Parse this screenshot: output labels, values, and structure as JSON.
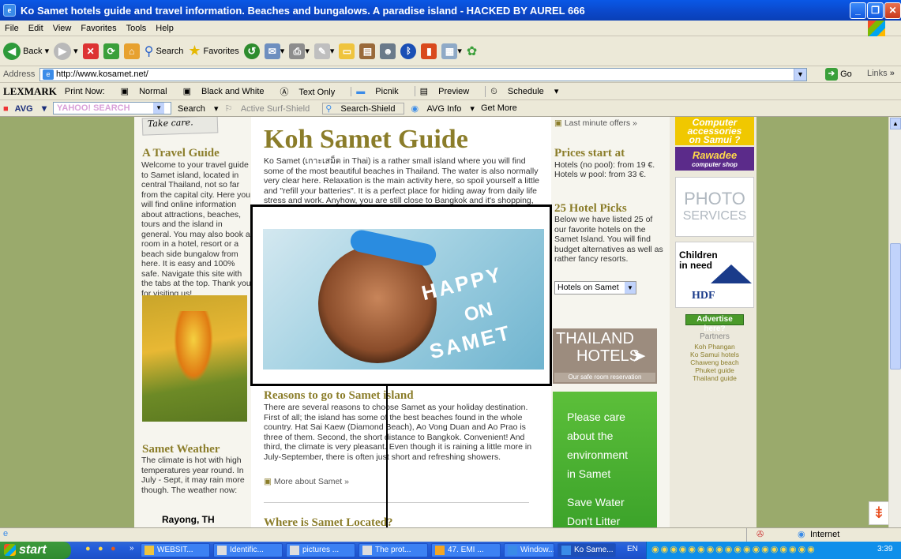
{
  "window": {
    "title": "Ko Samet hotels guide and travel information. Beaches and bungalows. A paradise island - HACKED BY AUREL 666"
  },
  "menu": [
    "File",
    "Edit",
    "View",
    "Favorites",
    "Tools",
    "Help"
  ],
  "toolbar": {
    "back": "Back",
    "search": "Search",
    "favorites": "Favorites"
  },
  "address": {
    "label": "Address",
    "url": "http://www.kosamet.net/",
    "go": "Go",
    "links": "Links"
  },
  "lexmark": {
    "brand": "LEXMARK",
    "print_now": "Print Now:",
    "normal": "Normal",
    "bw": "Black and White",
    "text_only": "Text Only",
    "picnik": "Picnik",
    "preview": "Preview",
    "schedule": "Schedule"
  },
  "avg": {
    "brand": "AVG",
    "search_box": "YAHOO! SEARCH",
    "search": "Search",
    "surf": "Active Surf-Shield",
    "search_shield": "Search-Shield",
    "info": "AVG Info",
    "more": "Get More"
  },
  "page": {
    "take_care": "Take care.",
    "left_title": "A Travel Guide",
    "left_body": "Welcome to your travel guide to Samet island, located in central Thailand, not so far from the capital city. Here you will find online information about attractions, beaches, tours and the island in general. You may also book a room in a hotel, resort or a beach side bungalow from here. It is easy and 100% safe. Navigate this site with the tabs at the top. Thank you for visiting us!",
    "weather_title": "Samet Weather",
    "weather_body": "The climate is hot with high temperatures year round. In July - Sept, it may rain more though. The weather now:",
    "weather_loc": "Rayong, TH",
    "main_title": "Koh Samet Guide",
    "main_intro": "Ko Samet (เกาะเสม็ด in Thai) is a rather small island where you will find some of the most beautiful beaches in Thailand. The water is also normally very clear here. Relaxation is the main activity here, so spoil yourself a little and \"refill your batteries\". It is a perfect place for hiding away from daily life stress and work. Anyhow, you are still close to Bangkok and it's shopping, night life and attractions.",
    "photo_caption_1": "HAPPY",
    "photo_caption_2": "ON",
    "photo_caption_3": "SAMET",
    "reasons_title": "Reasons to go to Samet island",
    "reasons_body": "There are several reasons to choose Samet as your holiday destination. First of all; the island has some of the best beaches found in the whole country. Hat Sai Kaew (Diamond Beach), Ao Vong Duan and Ao Prao is three of them. Second, the short distance to Bangkok. Convenient! And third, the climate is very pleasant. Even though it is raining a little more in July-September, there is often just short and refreshing showers.",
    "more_link": "More about Samet »",
    "where_title": "Where is Samet Located?",
    "last_minute": "Last minute offers »",
    "prices_title": "Prices start at",
    "prices_body_1": "Hotels (no pool): from 19 €.",
    "prices_body_2": "Hotels w pool: from 33 €.",
    "picks_title": "25 Hotel Picks",
    "picks_body": "Below we have listed 25 of our favorite hotels on the Samet Island. You will find budget alternatives as well as rather fancy resorts.",
    "hotels_select": "Hotels on Samet",
    "thai_hotels_1": "THAILAND",
    "thai_hotels_2": "HOTELS",
    "thai_hotels_sub": "Our safe room reservation",
    "env_1": "Please care",
    "env_2": "about the",
    "env_3": "environment",
    "env_4": "in Samet",
    "env_5": "Save Water",
    "env_6": "Don't Litter",
    "ad_computer_1": "Computer",
    "ad_computer_2": "accessories",
    "ad_computer_3": "on Samui ?",
    "rawadee": "Rawadee",
    "rawadee_sub": "computer shop",
    "photo_1": "PHOTO",
    "photo_2": "SERVICES",
    "children_1": "Children",
    "children_2": "in need",
    "hdf": "HDF",
    "advertise": "Advertise here?",
    "partners_title": "Partners",
    "partners": [
      "Koh Phangan",
      "Ko Samui hotels",
      "Chaweng beach",
      "Phuket guide",
      "Thailand guide"
    ]
  },
  "status": {
    "zone": "Internet"
  },
  "taskbar": {
    "start": "start",
    "tasks": [
      "WEBSIT...",
      "Identific...",
      "pictures ...",
      "The prot...",
      "47. EMI ...",
      "Window...",
      "Ko Same..."
    ],
    "lang": "EN",
    "clock": "3:39"
  }
}
